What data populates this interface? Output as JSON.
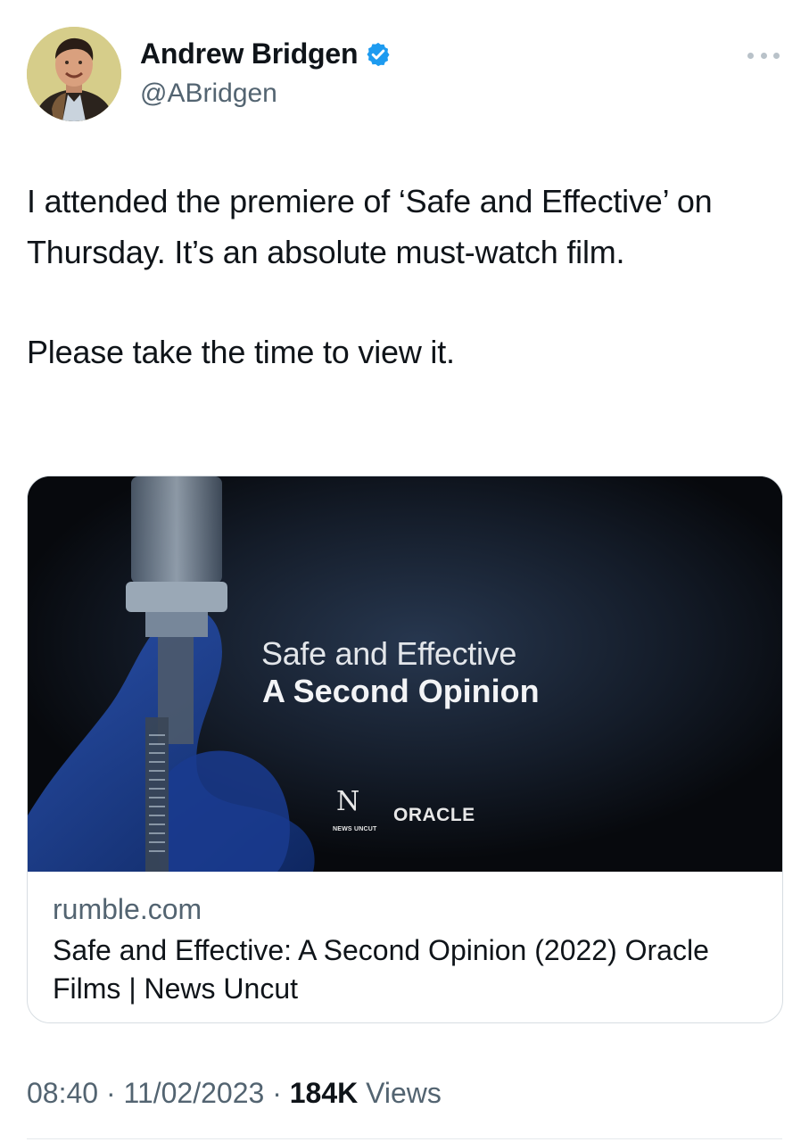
{
  "author": {
    "name": "Andrew Bridgen",
    "handle": "@ABridgen",
    "verified": true,
    "avatar_icon": "profile-photo"
  },
  "tweet": {
    "paragraphs": [
      "I attended the premiere of ‘Safe and Effective’ on Thursday. It’s an absolute must-watch film.",
      "Please take the time to view it."
    ]
  },
  "link_card": {
    "image": {
      "title": "Safe and Effective",
      "subtitle": "A Second Opinion",
      "logo_left": "N",
      "logo_left_caption": "NEWS UNCUT",
      "logo_right": "ORACLE"
    },
    "domain": "rumble.com",
    "title": "Safe and Effective: A Second Opinion (2022) Oracle Films | News Uncut"
  },
  "meta": {
    "time": "08:40",
    "separator": "·",
    "date": "11/02/2023",
    "views_count": "184K",
    "views_label": "Views"
  },
  "colors": {
    "text": "#0f1419",
    "secondary": "#536471",
    "verified": "#1d9bf0",
    "border": "#d7dde2"
  }
}
